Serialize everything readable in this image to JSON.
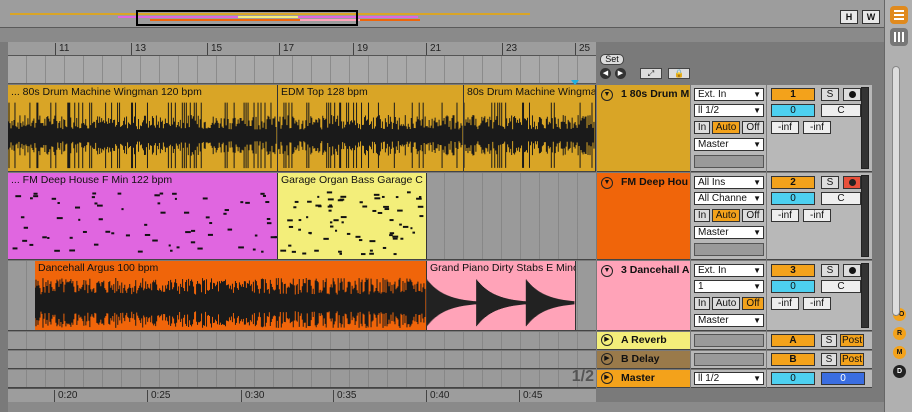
{
  "overview": {
    "h_button": "H",
    "w_button": "W"
  },
  "ruler": {
    "bars": [
      "11",
      "13",
      "15",
      "17",
      "19",
      "21",
      "23",
      "25"
    ]
  },
  "controls": {
    "set_label": "Set"
  },
  "tracks": [
    {
      "number_name": "1 80s Drum M",
      "clips": [
        "... 80s Drum Machine Wingman 120 bpm",
        "EDM Top 128 bpm",
        "80s Drum Machine Wingman"
      ],
      "input_type": "Ext. In",
      "input_channel": "ll 1/2",
      "monitor": [
        "In",
        "Auto",
        "Off"
      ],
      "output": "Master",
      "track_num": "1",
      "solo": "S",
      "volume": "0",
      "pan": "C",
      "peak_left": "-inf",
      "peak_right": "-inf"
    },
    {
      "number_name": "FM Deep Hou",
      "clips": [
        "... FM Deep House F Min 122 bpm",
        "Garage Organ Bass Garage C M"
      ],
      "input_type": "All Ins",
      "input_channel": "All Channe",
      "monitor": [
        "In",
        "Auto",
        "Off"
      ],
      "output": "Master",
      "track_num": "2",
      "solo": "S",
      "volume": "0",
      "pan": "C",
      "peak_left": "-inf",
      "peak_right": "-inf"
    },
    {
      "number_name": "3 Dancehall A",
      "clips": [
        "Dancehall Argus 100 bpm",
        "Grand Piano Dirty Stabs E Mino"
      ],
      "input_type": "Ext. In",
      "input_channel": "1",
      "monitor": [
        "In",
        "Auto",
        "Off"
      ],
      "output": "Master",
      "track_num": "3",
      "solo": "S",
      "volume": "0",
      "pan": "C",
      "peak_left": "-inf",
      "peak_right": "-inf"
    }
  ],
  "returns": [
    {
      "name": "A Reverb",
      "letter": "A",
      "solo": "S",
      "post": "Post"
    },
    {
      "name": "B Delay",
      "letter": "B",
      "solo": "S",
      "post": "Post"
    }
  ],
  "master": {
    "name": "Master",
    "channel": "1/2",
    "volume": "0",
    "pan": "0",
    "fraction": "1/2"
  },
  "timebar": {
    "marks": [
      "0:20",
      "0:25",
      "0:30",
      "0:35",
      "0:40",
      "0:45"
    ]
  },
  "side": {
    "io": "I·O",
    "r": "R",
    "m": "M",
    "d": "D"
  },
  "colors": {
    "drum": "#d9a526",
    "fm": "#e066e0",
    "garage": "#f3ee7a",
    "dance": "#f0650a",
    "piano": "#ffa3b8"
  }
}
